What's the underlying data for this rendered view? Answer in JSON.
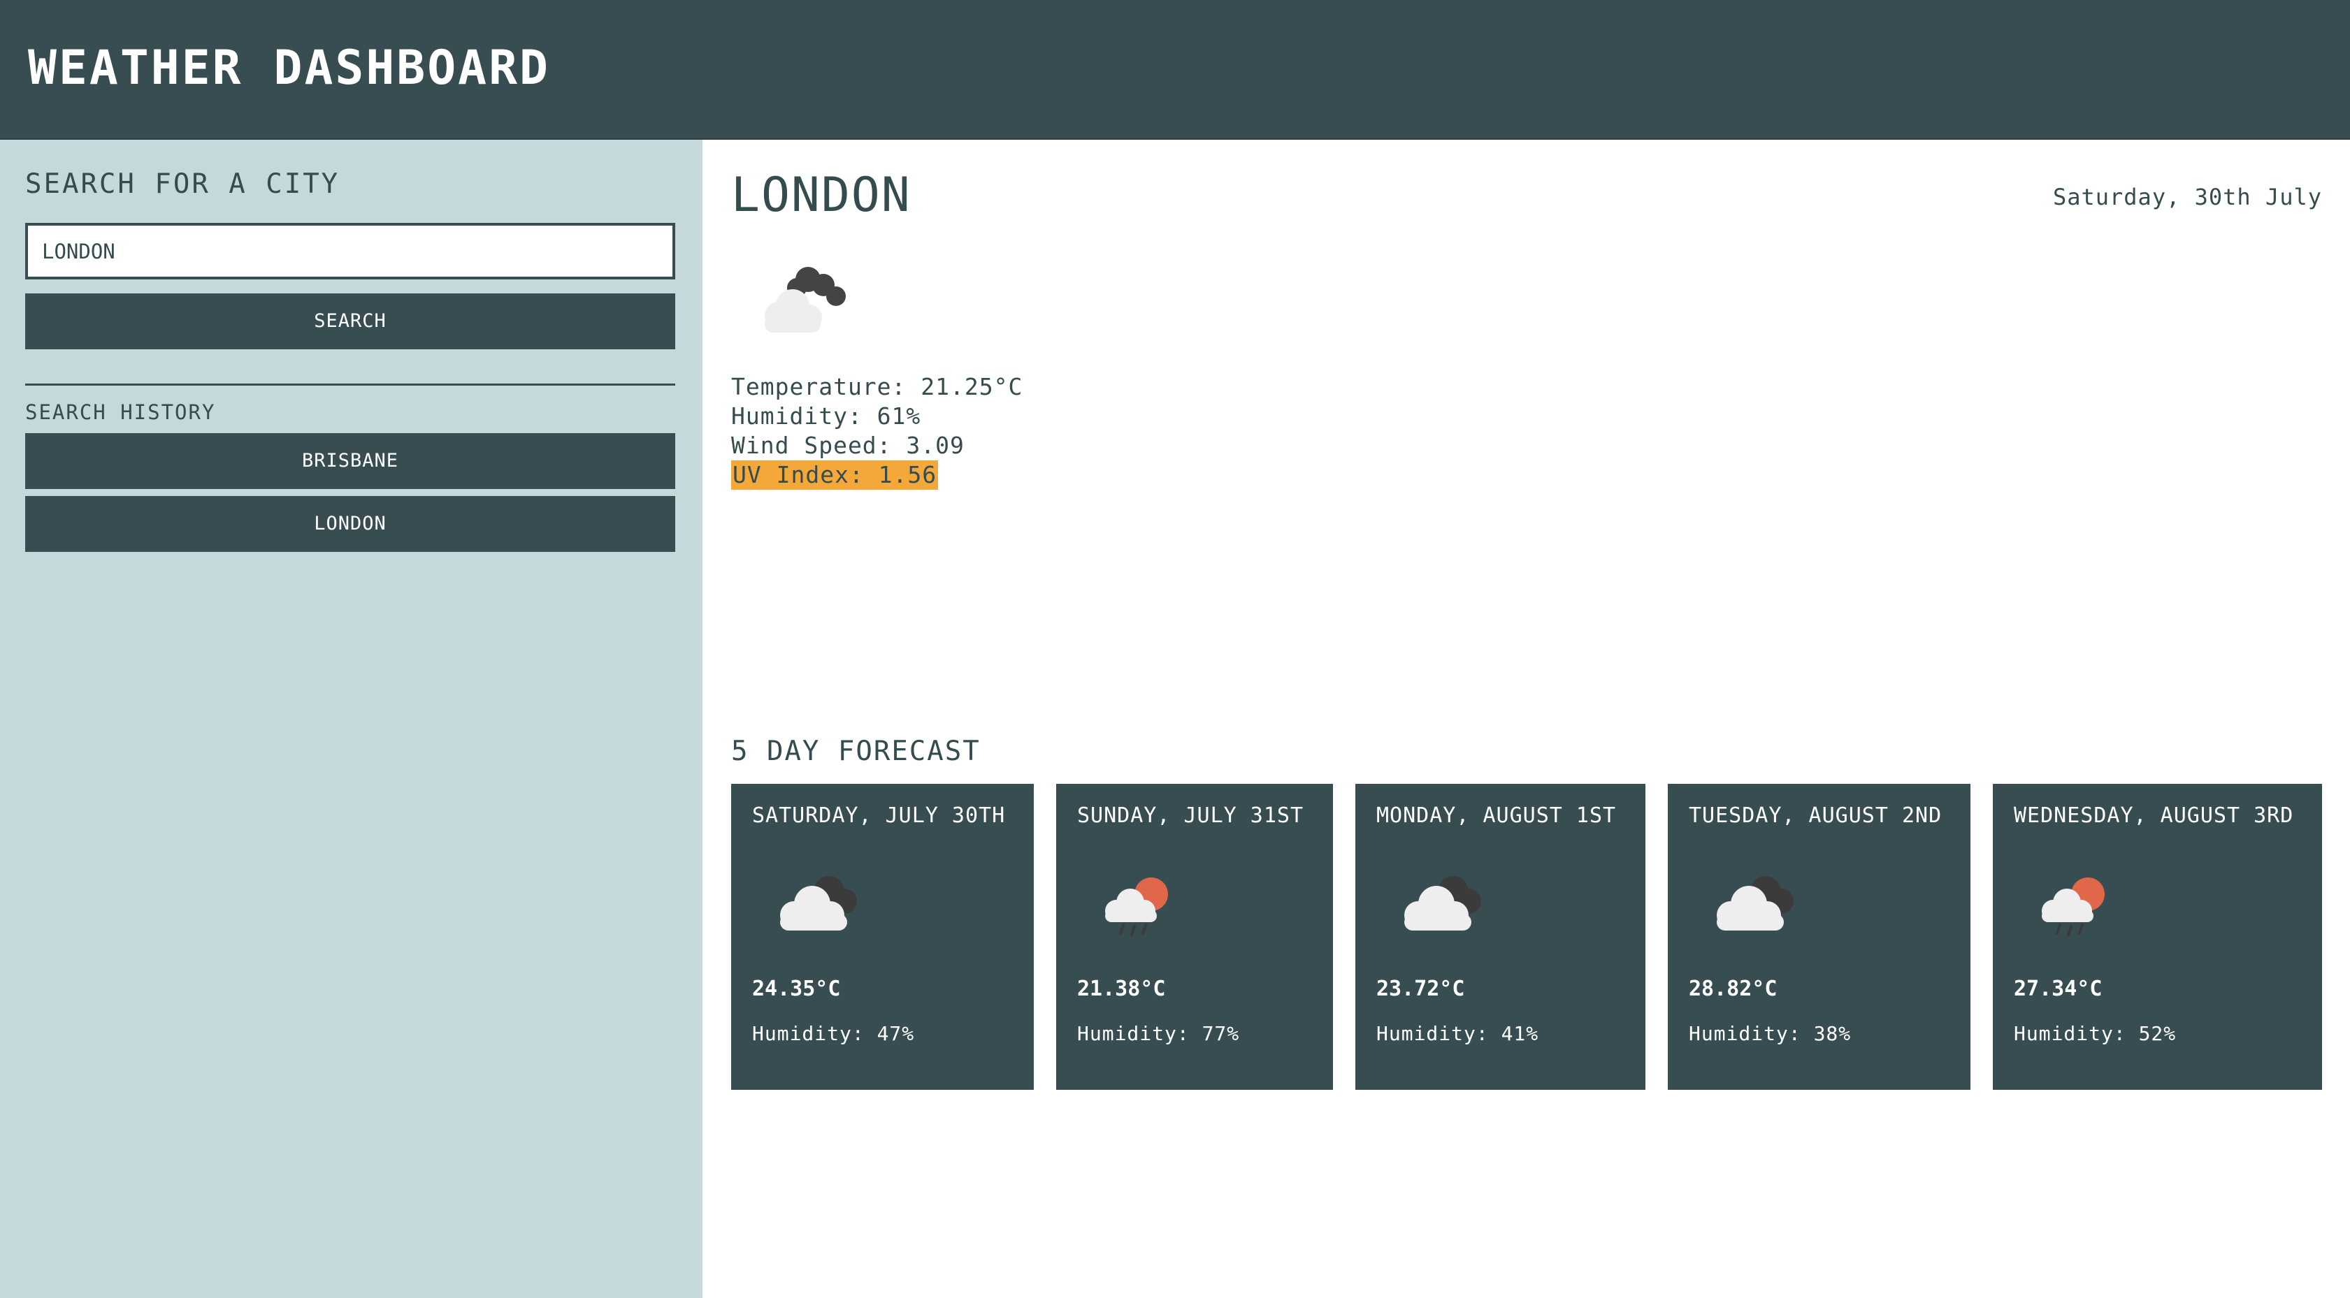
{
  "header": {
    "title": "WEATHER DASHBOARD"
  },
  "search": {
    "heading": "SEARCH FOR A CITY",
    "input_value": "LONDON",
    "button_label": "SEARCH"
  },
  "history": {
    "heading": "SEARCH HISTORY",
    "items": [
      {
        "label": "BRISBANE"
      },
      {
        "label": "LONDON"
      }
    ]
  },
  "current": {
    "city": "LONDON",
    "date": "Saturday, 30th July",
    "icon": "cloudy-dark-icon",
    "temperature": "Temperature: 21.25°C",
    "humidity": "Humidity: 61%",
    "wind_speed": "Wind Speed: 3.09",
    "uv_index": "UV Index: 1.56",
    "uv_color": "#f5a83a"
  },
  "forecast": {
    "heading": "5 DAY FORECAST",
    "days": [
      {
        "date": "SATURDAY, JULY 30TH",
        "icon": "cloudy-icon",
        "temp": "24.35°C",
        "humidity": "Humidity: 47%"
      },
      {
        "date": "SUNDAY, JULY 31ST",
        "icon": "sun-rain-cloud-icon",
        "temp": "21.38°C",
        "humidity": "Humidity: 77%"
      },
      {
        "date": "MONDAY, AUGUST 1ST",
        "icon": "cloudy-icon",
        "temp": "23.72°C",
        "humidity": "Humidity: 41%"
      },
      {
        "date": "TUESDAY, AUGUST 2ND",
        "icon": "cloudy-icon",
        "temp": "28.82°C",
        "humidity": "Humidity: 38%"
      },
      {
        "date": "WEDNESDAY, AUGUST 3RD",
        "icon": "sun-rain-cloud-icon",
        "temp": "27.34°C",
        "humidity": "Humidity: 52%"
      }
    ]
  },
  "colors": {
    "primary": "#374d51",
    "sidebar": "#c5d8dc",
    "text": "#354c4f",
    "uv_highlight": "#f5a83a"
  }
}
